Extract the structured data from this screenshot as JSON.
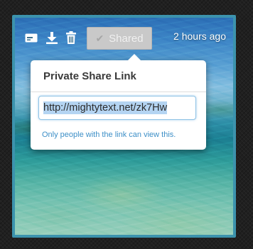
{
  "toolbar": {
    "icons": [
      "card-icon",
      "download-icon",
      "trash-icon"
    ],
    "shared_check": "✔",
    "shared_label": "Shared",
    "timestamp": "2 hours ago"
  },
  "popover": {
    "title": "Private Share Link",
    "link_value": "http://mightytext.net/zk7Hw",
    "note": "Only people with the link can view this."
  },
  "colors": {
    "frame_border": "#3c93ad",
    "shared_button_bg": "#c9c9c9",
    "link_selection": "#b4d4f2",
    "note_text": "#3d8fc7"
  }
}
